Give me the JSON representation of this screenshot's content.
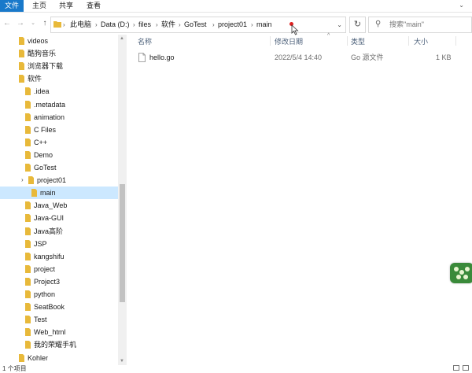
{
  "ribbon": {
    "tabs": [
      "文件",
      "主页",
      "共享",
      "查看"
    ],
    "toggle_icon": "chevron-down-icon"
  },
  "address_bar": {
    "breadcrumbs": [
      "此电脑",
      "Data (D:)",
      "files",
      "软件",
      "GoTest",
      "project01",
      "main"
    ],
    "separator": "›"
  },
  "search": {
    "placeholder": "搜索\"main\""
  },
  "nav_tree": [
    {
      "label": "videos",
      "level": 0
    },
    {
      "label": "酷狗音乐",
      "level": 0
    },
    {
      "label": "浏览器下载",
      "level": 0
    },
    {
      "label": "软件",
      "level": 0
    },
    {
      "label": ".idea",
      "level": 1
    },
    {
      "label": ".metadata",
      "level": 1
    },
    {
      "label": "animation",
      "level": 1
    },
    {
      "label": "C Files",
      "level": 1
    },
    {
      "label": "C++",
      "level": 1
    },
    {
      "label": "Demo",
      "level": 1
    },
    {
      "label": "GoTest",
      "level": 1
    },
    {
      "label": "project01",
      "level": 2
    },
    {
      "label": "main",
      "level": 3,
      "selected": true
    },
    {
      "label": "Java_Web",
      "level": 1
    },
    {
      "label": "Java-GUI",
      "level": 1
    },
    {
      "label": "Java高阶",
      "level": 1
    },
    {
      "label": "JSP",
      "level": 1
    },
    {
      "label": "kangshifu",
      "level": 1
    },
    {
      "label": "project",
      "level": 1
    },
    {
      "label": "Project3",
      "level": 1
    },
    {
      "label": "python",
      "level": 1
    },
    {
      "label": "SeatBook",
      "level": 1
    },
    {
      "label": "Test",
      "level": 1
    },
    {
      "label": "Web_html",
      "level": 1
    },
    {
      "label": "我的荣耀手机",
      "level": 1
    },
    {
      "label": "Kohler",
      "level": 0
    }
  ],
  "columns": {
    "name": "名称",
    "date": "修改日期",
    "type": "类型",
    "size": "大小"
  },
  "files": [
    {
      "name": "hello.go",
      "date": "2022/5/4 14:40",
      "type": "Go 源文件",
      "size": "1 KB",
      "icon": "file-icon"
    }
  ],
  "status_bar": {
    "text": "1 个项目"
  },
  "colors": {
    "accent": "#1979ca",
    "selection": "#cce8ff",
    "folder": "#e8b93a",
    "header_text": "#4c607a"
  }
}
